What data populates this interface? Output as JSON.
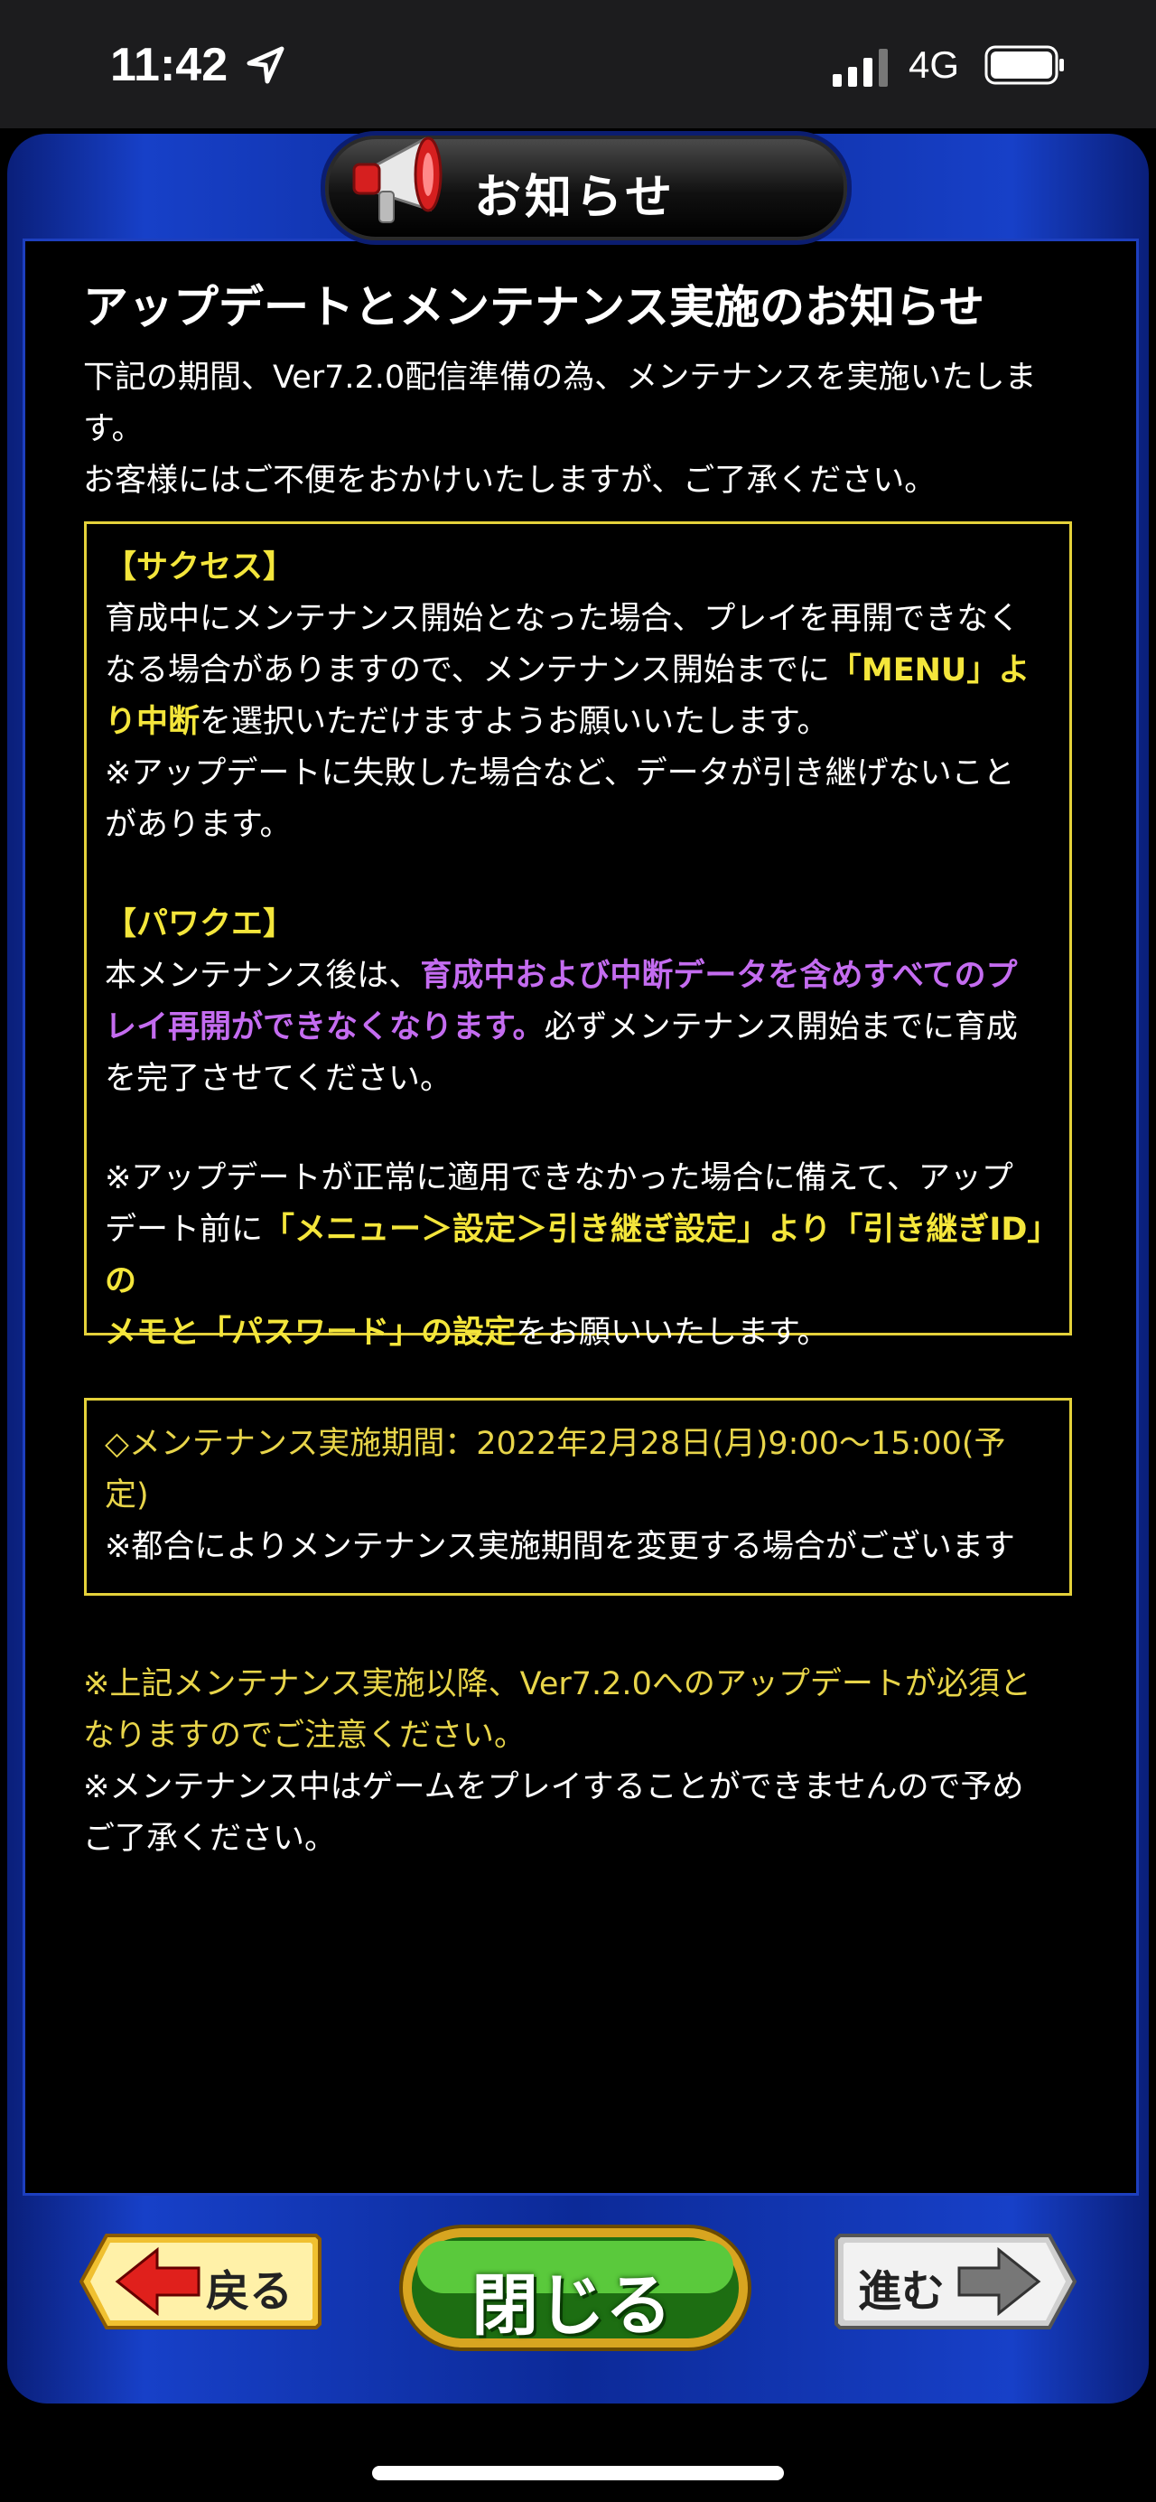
{
  "status_bar": {
    "time": "11:42",
    "network": "4G",
    "icons": [
      "location-arrow-icon",
      "signal-icon",
      "battery-icon"
    ]
  },
  "header": {
    "title": "お知らせ",
    "icon": "megaphone-icon"
  },
  "notice": {
    "title": "アップデートとメンテナンス実施のお知らせ",
    "intro_line1": "下記の期間、Ver7.2.0配信準備の為、メンテナンスを実施いたしま",
    "intro_line2": "す。",
    "intro_line3": "お客様にはご不便をおかけいたしますが、ご了承ください。",
    "box1": {
      "success_heading": "【サクセス】",
      "success_l1": "育成中にメンテナンス開始となった場合、プレイを再開できなく",
      "success_l2": "なる場合がありますので、メンテナンス開始までに",
      "success_l2_hl": "「MENU」よ",
      "success_l3_hl": "り中断",
      "success_l3": "を選択いただけますようお願いいたします。",
      "success_l4": "※アップデートに失敗した場合など、データが引き継げないこと",
      "success_l5": "があります。",
      "pawakue_heading": "【パワクエ】",
      "pawakue_l1": "本メンテナンス後は、",
      "pawakue_l1_hl": "育成中および中断データを含めすべてのプ",
      "pawakue_l2_hl": "レイ再開ができなくなります。",
      "pawakue_l2": "必ずメンテナンス開始までに育成",
      "pawakue_l3": "を完了させてください。",
      "update_l1": "※アップデートが正常に適用できなかった場合に備えて、アップ",
      "update_l2": "デート前に",
      "update_l2_hl": "「メニュー＞設定＞引き継ぎ設定」より「引き継ぎID」の",
      "update_l3_hl": "メモと「パスワード」の設定",
      "update_l3": "をお願いいたします。"
    },
    "box2": {
      "period_l1": "◇メンテナンス実施期間：2022年2月28日(月)9:00～15:00(予",
      "period_l2": "定)",
      "period_l3": "※都合によりメンテナンス実施期間を変更する場合がございます"
    },
    "footer_l1": "※上記メンテナンス実施以降、Ver7.2.0へのアップデートが必須と",
    "footer_l2": "なりますのでご注意ください。",
    "footer_l3": "※メンテナンス中はゲームをプレイすることができませんので予め",
    "footer_l4": "ご了承ください。"
  },
  "buttons": {
    "back_label": "戻る",
    "close_label": "閉じる",
    "next_label": "進む"
  },
  "colors": {
    "frame_blue": "#1740c8",
    "highlight_yellow": "#f4e63b",
    "highlight_purple": "#c46cf0",
    "close_green": "#2f9a1e"
  }
}
